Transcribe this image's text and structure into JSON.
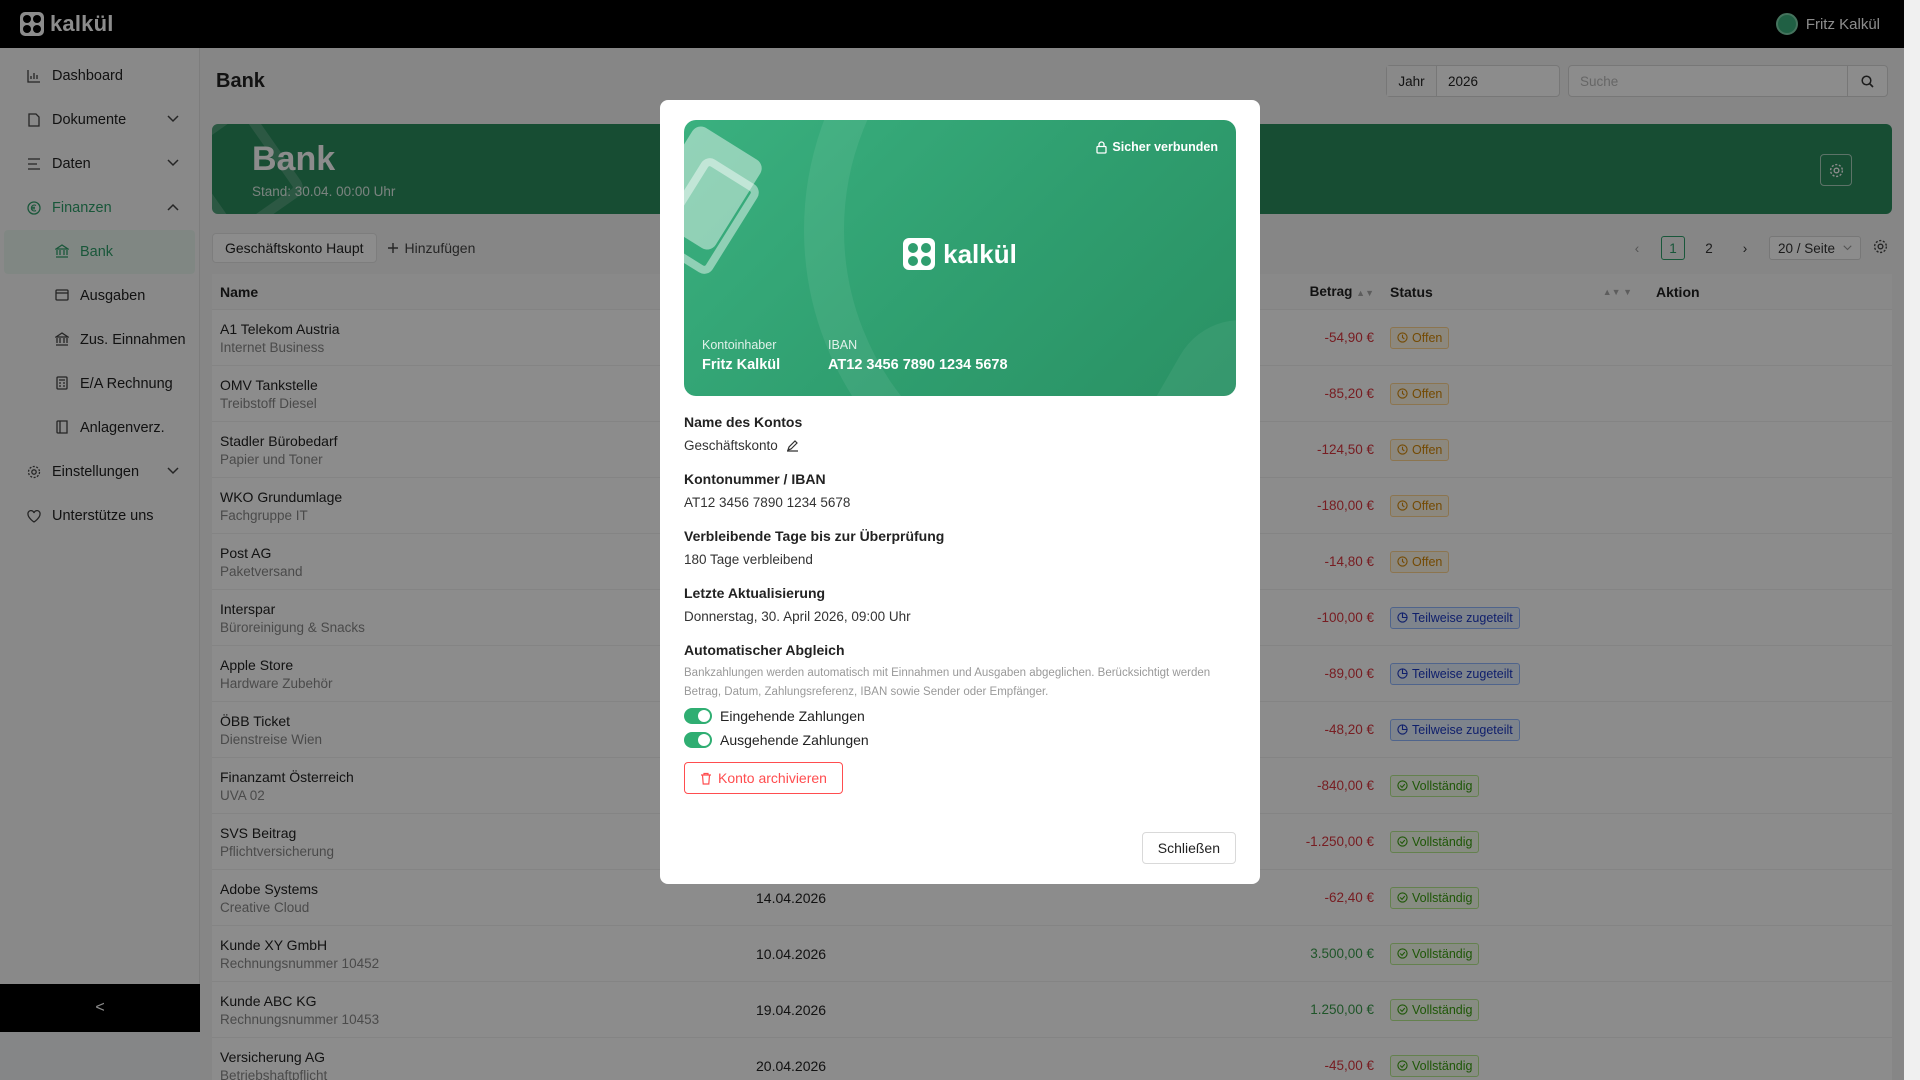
{
  "app": {
    "brand": "kalkül",
    "user_name": "Fritz Kalkül"
  },
  "sidebar": {
    "items": [
      {
        "label": "Dashboard",
        "icon": "chart-icon"
      },
      {
        "label": "Dokumente",
        "icon": "document-icon",
        "expandable": true
      },
      {
        "label": "Daten",
        "icon": "list-icon",
        "expandable": true
      },
      {
        "label": "Finanzen",
        "icon": "euro-icon",
        "expanded": true
      }
    ],
    "finanzen_sub": [
      {
        "label": "Bank",
        "icon": "bank-icon",
        "active": true
      },
      {
        "label": "Ausgaben",
        "icon": "wallet-icon"
      },
      {
        "label": "Zus. Einnahmen",
        "icon": "bank-icon"
      },
      {
        "label": "E/A Rechnung",
        "icon": "calculator-icon"
      },
      {
        "label": "Anlagenverz.",
        "icon": "book-icon"
      }
    ],
    "bottom_items": [
      {
        "label": "Einstellungen",
        "icon": "gear-icon"
      },
      {
        "label": "Unterstütze uns",
        "icon": "heart-icon"
      }
    ],
    "collapse_glyph": "<"
  },
  "header": {
    "title": "Bank",
    "year_label": "Jahr",
    "year_value": "2026",
    "search_placeholder": "Suche"
  },
  "banner": {
    "title": "Bank",
    "subtitle": "Stand: 30.04. 00:00 Uhr"
  },
  "toolbar": {
    "account_tab": "Geschäftskonto Haupt",
    "add_label": "Hinzufügen",
    "pages": [
      "1",
      "2"
    ],
    "current_page": "1",
    "page_size": "20 / Seite"
  },
  "table": {
    "columns": {
      "name": "Name",
      "amount": "Betrag",
      "status": "Status",
      "action": "Aktion"
    },
    "rows": [
      {
        "name": "A1 Telekom Austria",
        "desc": "Internet Business",
        "date": "",
        "amount": "-54,90 €",
        "sign": "neg",
        "status": "Offen",
        "kind": "open"
      },
      {
        "name": "OMV Tankstelle",
        "desc": "Treibstoff Diesel",
        "date": "",
        "amount": "-85,20 €",
        "sign": "neg",
        "status": "Offen",
        "kind": "open"
      },
      {
        "name": "Stadler Bürobedarf",
        "desc": "Papier und Toner",
        "date": "",
        "amount": "-124,50 €",
        "sign": "neg",
        "status": "Offen",
        "kind": "open"
      },
      {
        "name": "WKO Grundumlage",
        "desc": "Fachgruppe IT",
        "date": "",
        "amount": "-180,00 €",
        "sign": "neg",
        "status": "Offen",
        "kind": "open"
      },
      {
        "name": "Post AG",
        "desc": "Paketversand",
        "date": "",
        "amount": "-14,80 €",
        "sign": "neg",
        "status": "Offen",
        "kind": "open"
      },
      {
        "name": "Interspar",
        "desc": "Büroreinigung & Snacks",
        "date": "",
        "amount": "-100,00 €",
        "sign": "neg",
        "status": "Teilweise zugeteilt",
        "kind": "part"
      },
      {
        "name": "Apple Store",
        "desc": "Hardware Zubehör",
        "date": "",
        "amount": "-89,00 €",
        "sign": "neg",
        "status": "Teilweise zugeteilt",
        "kind": "part"
      },
      {
        "name": "ÖBB Ticket",
        "desc": "Dienstreise Wien",
        "date": "",
        "amount": "-48,20 €",
        "sign": "neg",
        "status": "Teilweise zugeteilt",
        "kind": "part"
      },
      {
        "name": "Finanzamt Österreich",
        "desc": "UVA 02",
        "date": "",
        "amount": "-840,00 €",
        "sign": "neg",
        "status": "Vollständig",
        "kind": "full"
      },
      {
        "name": "SVS Beitrag",
        "desc": "Pflichtversicherung",
        "date": "",
        "amount": "-1.250,00 €",
        "sign": "neg",
        "status": "Vollständig",
        "kind": "full"
      },
      {
        "name": "Adobe Systems",
        "desc": "Creative Cloud",
        "date": "14.04.2026",
        "amount": "-62,40 €",
        "sign": "neg",
        "status": "Vollständig",
        "kind": "full"
      },
      {
        "name": "Kunde XY GmbH",
        "desc": "Rechnungsnummer 10452",
        "date": "10.04.2026",
        "amount": "3.500,00 €",
        "sign": "pos",
        "status": "Vollständig",
        "kind": "full"
      },
      {
        "name": "Kunde ABC KG",
        "desc": "Rechnungsnummer 10453",
        "date": "19.04.2026",
        "amount": "1.250,00 €",
        "sign": "pos",
        "status": "Vollständig",
        "kind": "full"
      },
      {
        "name": "Versicherung AG",
        "desc": "Betriebshaftpflicht",
        "date": "20.04.2026",
        "amount": "-45,00 €",
        "sign": "neg",
        "status": "Vollständig",
        "kind": "full"
      }
    ]
  },
  "modal": {
    "card": {
      "secure_label": "Sicher verbunden",
      "brand": "kalkül",
      "holder_label": "Kontoinhaber",
      "holder_value": "Fritz Kalkül",
      "iban_label": "IBAN",
      "iban_value": "AT12 3456 7890 1234 5678"
    },
    "account_name_label": "Name des Kontos",
    "account_name_value": "Geschäftskonto",
    "account_number_label": "Kontonummer / IBAN",
    "account_number_value": "AT12 3456 7890 1234 5678",
    "days_label": "Verbleibende Tage bis zur Überprüfung",
    "days_value": "180 Tage verbleibend",
    "last_update_label": "Letzte Aktualisierung",
    "last_update_value": "Donnerstag, 30. April 2026, 09:00 Uhr",
    "auto_label": "Automatischer Abgleich",
    "auto_desc": "Bankzahlungen werden automatisch mit Einnahmen und Ausgaben abgeglichen. Berücksichtigt werden Betrag, Datum, Zahlungsreferenz, IBAN sowie Sender oder Empfänger.",
    "incoming_label": "Eingehende Zahlungen",
    "incoming_on": true,
    "outgoing_label": "Ausgehende Zahlungen",
    "outgoing_on": true,
    "archive_label": "Konto archivieren",
    "close_label": "Schließen"
  },
  "colors": {
    "brand_green": "#2f9e6a",
    "danger": "#ff4d4f",
    "topbar": "#000000"
  }
}
